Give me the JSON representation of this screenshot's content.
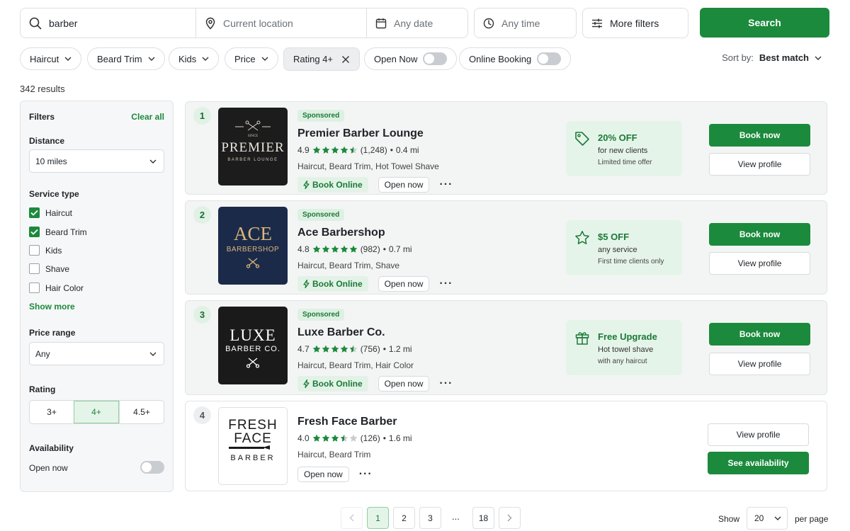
{
  "search": {
    "query": "barber",
    "location_placeholder": "Current location",
    "date_placeholder": "Any date",
    "time_placeholder": "Any time",
    "more_filters": "More filters",
    "search_button": "Search"
  },
  "chips": {
    "haircut": "Haircut",
    "beard_trim": "Beard Trim",
    "kids": "Kids",
    "price": "Price",
    "rating": "Rating 4+",
    "open_now": "Open Now",
    "online_booking": "Online Booking"
  },
  "sort": {
    "label": "Sort by:",
    "value": "Best match"
  },
  "results_count": "342 results",
  "sidebar": {
    "title": "Filters",
    "clear_all": "Clear all",
    "distance_label": "Distance",
    "distance_value": "10 miles",
    "service_type_label": "Service type",
    "services": [
      {
        "label": "Haircut",
        "checked": true
      },
      {
        "label": "Beard Trim",
        "checked": true
      },
      {
        "label": "Kids",
        "checked": false
      },
      {
        "label": "Shave",
        "checked": false
      },
      {
        "label": "Hair Color",
        "checked": false
      }
    ],
    "show_more": "Show more",
    "price_label": "Price range",
    "price_value": "Any",
    "rating_label": "Rating",
    "rating_options": [
      "3+",
      "4+",
      "4.5+"
    ],
    "rating_selected": "4+",
    "availability_label": "Availability",
    "open_now_label": "Open now"
  },
  "results": [
    {
      "rank": "1",
      "sponsored": "Sponsored",
      "name": "Premier Barber Lounge",
      "rating": "4.9",
      "stars": 4.5,
      "reviews": "(1,248)",
      "distance": "0.4 mi",
      "services": "Haircut, Beard Trim, Hot Towel Shave",
      "book_tag": "Book Online",
      "open_tag": "Open now",
      "offer": {
        "icon": "tag-icon",
        "title": "20% OFF",
        "sub": "for new clients",
        "note": "Limited time offer"
      },
      "book_button": "Book now",
      "view_button": "View profile",
      "logo": {
        "line1": "PREMIER",
        "line2": "BARBER LOUNGE",
        "small": "SINCE",
        "bg": "#1c1c1c",
        "fg": "#e9e4da"
      }
    },
    {
      "rank": "2",
      "sponsored": "Sponsored",
      "name": "Ace Barbershop",
      "rating": "4.8",
      "stars": 5,
      "reviews": "(982)",
      "distance": "0.7 mi",
      "services": "Haircut, Beard Trim, Shave",
      "book_tag": "Book Online",
      "open_tag": "Open now",
      "offer": {
        "icon": "star-icon",
        "title": "$5 OFF",
        "sub": "any service",
        "note": "First time clients only"
      },
      "book_button": "Book now",
      "view_button": "View profile",
      "logo": {
        "line1": "ACE",
        "line2": "BARBERSHOP",
        "bg": "#1c2a4a",
        "fg": "#d9b877"
      }
    },
    {
      "rank": "3",
      "sponsored": "Sponsored",
      "name": "Luxe Barber Co.",
      "rating": "4.7",
      "stars": 4.5,
      "reviews": "(756)",
      "distance": "1.2 mi",
      "services": "Haircut, Beard Trim, Hair Color",
      "book_tag": "Book Online",
      "open_tag": "Open now",
      "offer": {
        "icon": "gift-icon",
        "title": "Free Upgrade",
        "sub": "Hot towel shave",
        "note": "with any haircut"
      },
      "book_button": "Book now",
      "view_button": "View profile",
      "logo": {
        "line1": "LUXE",
        "line2": "BARBER CO.",
        "bg": "#1a1a1a",
        "fg": "#ffffff"
      }
    },
    {
      "rank": "4",
      "name": "Fresh Face Barber",
      "rating": "4.0",
      "stars": 3.5,
      "reviews": "(126)",
      "distance": "1.6 mi",
      "services": "Haircut, Beard Trim",
      "open_tag": "Open now",
      "view_button": "View profile",
      "availability_button": "See availability",
      "logo": {
        "line1": "FRESH",
        "line2": "FACE",
        "line3": "BARBER",
        "bg": "#ffffff",
        "fg": "#1a1a1a"
      }
    }
  ],
  "pagination": {
    "pages": [
      "1",
      "2",
      "3",
      "18"
    ],
    "ellipsis": "...",
    "current": "1",
    "show_label": "Show",
    "per_page_value": "20",
    "per_page_label": "per page"
  },
  "colors": {
    "accent": "#1b8a3c",
    "accent_light": "#e5f4e9",
    "star": "#1b8a3c"
  }
}
